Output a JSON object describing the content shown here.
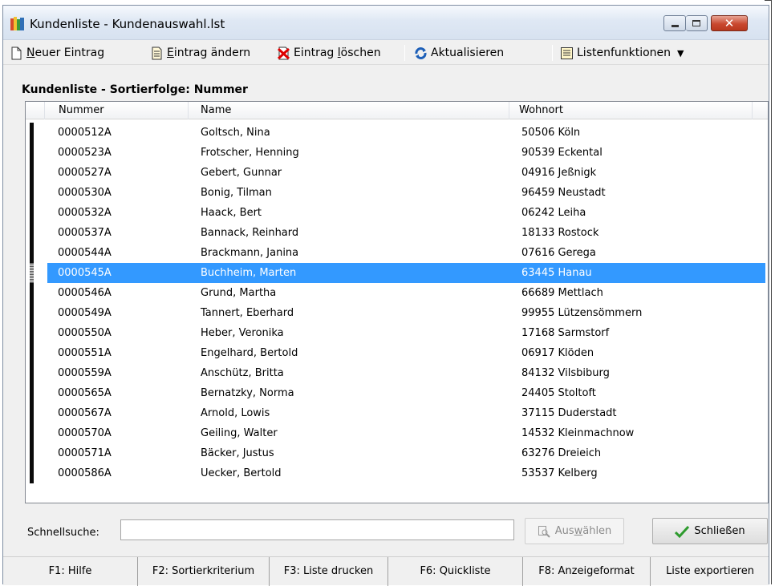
{
  "window": {
    "title": "Kundenliste - Kundenauswahl.lst",
    "controls": {
      "minimize": "minimize",
      "maximize": "maximize",
      "close": "✕"
    }
  },
  "toolbar": {
    "new_entry": {
      "prefix": "",
      "accel": "N",
      "rest": "euer Eintrag"
    },
    "edit_entry": {
      "accel": "E",
      "rest": "intrag ändern"
    },
    "delete_entry": {
      "prefix": "Eintrag ",
      "accel": "l",
      "rest": "öschen"
    },
    "refresh": "Aktualisieren",
    "list_functions": "Listenfunktionen"
  },
  "list": {
    "title": "Kundenliste - Sortierfolge: Nummer",
    "columns": [
      "Nummer",
      "Name",
      "Wohnort"
    ],
    "rows": [
      {
        "num": "0000512A",
        "name": "Goltsch, Nina",
        "ort": "50506 Köln"
      },
      {
        "num": "0000523A",
        "name": "Frotscher, Henning",
        "ort": "90539 Eckental"
      },
      {
        "num": "0000527A",
        "name": "Gebert, Gunnar",
        "ort": "04916 Jeßnigk"
      },
      {
        "num": "0000530A",
        "name": "Bonig, Tilman",
        "ort": "96459 Neustadt"
      },
      {
        "num": "0000532A",
        "name": "Haack, Bert",
        "ort": "06242 Leiha"
      },
      {
        "num": "0000537A",
        "name": "Bannack, Reinhard",
        "ort": "18133 Rostock"
      },
      {
        "num": "0000544A",
        "name": "Brackmann, Janina",
        "ort": "07616 Gerega"
      },
      {
        "num": "0000545A",
        "name": "Buchheim, Marten",
        "ort": "63445 Hanau"
      },
      {
        "num": "0000546A",
        "name": "Grund, Martha",
        "ort": "66689 Mettlach"
      },
      {
        "num": "0000549A",
        "name": "Tannert, Eberhard",
        "ort": "99955 Lützensömmern"
      },
      {
        "num": "0000550A",
        "name": "Heber, Veronika",
        "ort": "17168 Sarmstorf"
      },
      {
        "num": "0000551A",
        "name": "Engelhard, Bertold",
        "ort": "06917 Klöden"
      },
      {
        "num": "0000559A",
        "name": "Anschütz, Britta",
        "ort": "84132 Vilsbiburg"
      },
      {
        "num": "0000565A",
        "name": "Bernatzky, Norma",
        "ort": "24405 Stoltoft"
      },
      {
        "num": "0000567A",
        "name": "Arnold, Lowis",
        "ort": "37115 Duderstadt"
      },
      {
        "num": "0000570A",
        "name": "Geiling, Walter",
        "ort": "14532 Kleinmachnow"
      },
      {
        "num": "0000571A",
        "name": "Bäcker, Justus",
        "ort": "63276 Dreieich"
      },
      {
        "num": "0000586A",
        "name": "Uecker, Bertold",
        "ort": "53537 Kelberg"
      }
    ],
    "selected_index": 7,
    "selection_color": "#3399ff"
  },
  "search": {
    "label": "Schnellsuche:",
    "value": ""
  },
  "buttons": {
    "select": {
      "prefix": "Aus",
      "accel": "w",
      "rest": "ählen",
      "enabled": false
    },
    "close": "Schließen"
  },
  "function_keys": [
    "F1: Hilfe",
    "F2: Sortierkriterium",
    "F3: Liste drucken",
    "F6: Quickliste",
    "F8: Anzeigeformat",
    "Liste exportieren"
  ]
}
